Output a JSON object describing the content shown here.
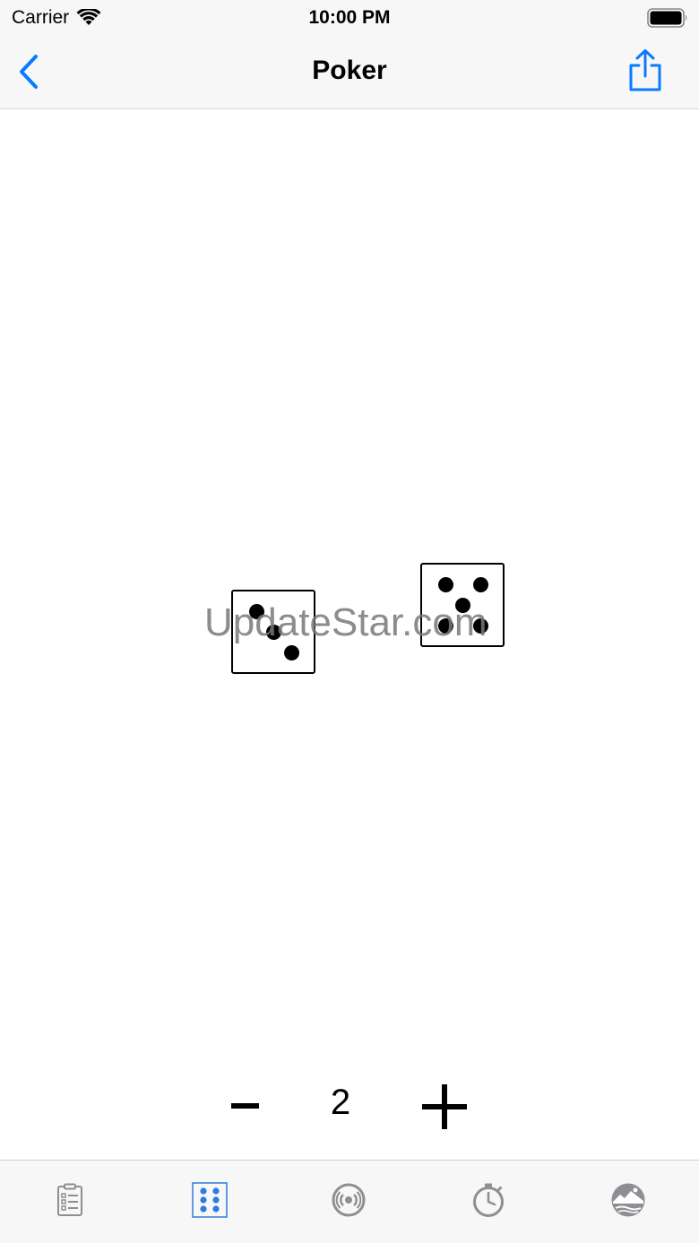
{
  "status_bar": {
    "carrier": "Carrier",
    "time": "10:00 PM"
  },
  "nav": {
    "title": "Poker",
    "back_icon": "chevron-left-icon",
    "share_icon": "share-icon"
  },
  "dice": [
    {
      "face": 3
    },
    {
      "face": 5
    }
  ],
  "watermark": "UpdateStar.com",
  "stepper": {
    "value": "2",
    "minus_label": "−",
    "plus_label": "+"
  },
  "tab_bar": {
    "selected_index": 1,
    "accent_color": "#2a7de1",
    "inactive_color": "#8e8e93",
    "tabs": [
      {
        "icon": "clipboard-list-icon"
      },
      {
        "icon": "dice-icon"
      },
      {
        "icon": "radio-signal-icon"
      },
      {
        "icon": "stopwatch-icon"
      },
      {
        "icon": "landscape-icon"
      }
    ]
  },
  "colors": {
    "accent": "#0a7aff",
    "bar_background": "#f7f7f7"
  }
}
